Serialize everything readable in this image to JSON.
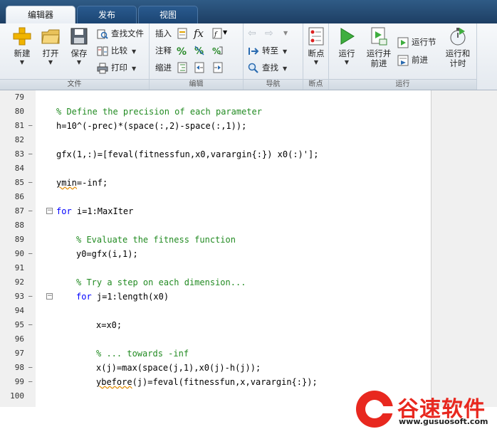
{
  "tabs": [
    {
      "label": "编辑器",
      "active": true
    },
    {
      "label": "发布",
      "active": false
    },
    {
      "label": "视图",
      "active": false
    }
  ],
  "ribbon": {
    "file": {
      "group_label": "文件",
      "new_label": "新建",
      "open_label": "打开",
      "save_label": "保存",
      "find_files_label": "查找文件",
      "compare_label": "比较",
      "print_label": "打印"
    },
    "edit": {
      "group_label": "编辑",
      "insert_label": "插入",
      "comment_label": "注释",
      "indent_label": "缩进",
      "fx_label": "fx"
    },
    "navigate": {
      "group_label": "导航",
      "goto_label": "转至",
      "find_label": "查找"
    },
    "breakpoints": {
      "group_label": "断点",
      "breakpoints_label": "断点"
    },
    "run": {
      "group_label": "运行",
      "run_label": "运行",
      "run_advance_label": "运行并\n前进",
      "run_section_label": "运行节",
      "advance_label": "前进",
      "run_time_label": "运行和\n计时"
    }
  },
  "editor": {
    "lines": [
      {
        "num": "79",
        "dash": false,
        "fold": false,
        "indent": 0,
        "type": "code",
        "text": ""
      },
      {
        "num": "80",
        "dash": false,
        "fold": false,
        "indent": 0,
        "type": "comment",
        "text": "% Define the precision of each parameter"
      },
      {
        "num": "81",
        "dash": true,
        "fold": false,
        "indent": 0,
        "type": "code",
        "text": "h=10^(-prec)*(space(:,2)-space(:,1));"
      },
      {
        "num": "82",
        "dash": false,
        "fold": false,
        "indent": 0,
        "type": "code",
        "text": ""
      },
      {
        "num": "83",
        "dash": true,
        "fold": false,
        "indent": 0,
        "type": "code",
        "text": "gfx(1,:)=[feval(fitnessfun,x0,varargin{:}) x0(:)'];"
      },
      {
        "num": "84",
        "dash": false,
        "fold": false,
        "indent": 0,
        "type": "code",
        "text": ""
      },
      {
        "num": "85",
        "dash": true,
        "fold": false,
        "indent": 0,
        "type": "code",
        "text": "ymin=-inf;"
      },
      {
        "num": "86",
        "dash": false,
        "fold": false,
        "indent": 0,
        "type": "code",
        "text": ""
      },
      {
        "num": "87",
        "dash": true,
        "fold": true,
        "indent": 0,
        "type": "keyword",
        "text": "for i=1:MaxIter"
      },
      {
        "num": "88",
        "dash": false,
        "fold": false,
        "indent": 0,
        "type": "code",
        "text": ""
      },
      {
        "num": "89",
        "dash": false,
        "fold": false,
        "indent": 1,
        "type": "comment",
        "text": "% Evaluate the fitness function"
      },
      {
        "num": "90",
        "dash": true,
        "fold": false,
        "indent": 1,
        "type": "code",
        "text": "y0=gfx(i,1);"
      },
      {
        "num": "91",
        "dash": false,
        "fold": false,
        "indent": 0,
        "type": "code",
        "text": ""
      },
      {
        "num": "92",
        "dash": false,
        "fold": false,
        "indent": 1,
        "type": "comment",
        "text": "% Try a step on each dimension..."
      },
      {
        "num": "93",
        "dash": true,
        "fold": true,
        "indent": 1,
        "type": "keyword",
        "text": "for j=1:length(x0)"
      },
      {
        "num": "94",
        "dash": false,
        "fold": false,
        "indent": 0,
        "type": "code",
        "text": ""
      },
      {
        "num": "95",
        "dash": true,
        "fold": false,
        "indent": 2,
        "type": "code",
        "text": "x=x0;"
      },
      {
        "num": "96",
        "dash": false,
        "fold": false,
        "indent": 0,
        "type": "code",
        "text": ""
      },
      {
        "num": "97",
        "dash": false,
        "fold": false,
        "indent": 2,
        "type": "comment",
        "text": "% ... towards -inf"
      },
      {
        "num": "98",
        "dash": true,
        "fold": false,
        "indent": 2,
        "type": "code",
        "text": "x(j)=max(space(j,1),x0(j)-h(j));"
      },
      {
        "num": "99",
        "dash": true,
        "fold": false,
        "indent": 2,
        "type": "code",
        "text": "ybefore(j)=feval(fitnessfun,x,varargin{:});"
      },
      {
        "num": "100",
        "dash": false,
        "fold": false,
        "indent": 0,
        "type": "code",
        "text": ""
      }
    ]
  },
  "watermark": {
    "brand": "谷速软件",
    "url": "www.gusuosoft.com"
  },
  "colors": {
    "comment": "#228b22",
    "keyword": "#0000ff",
    "brand": "#e8281f"
  }
}
